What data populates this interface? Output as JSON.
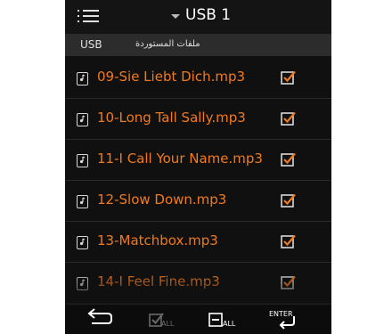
{
  "header": {
    "title": "USB 1",
    "menu_icon": "hamburger-menu-icon",
    "dropdown_icon": "caret-down-icon"
  },
  "breadcrumb": {
    "source": "USB",
    "folder": "ملفات المستوردة"
  },
  "files": [
    {
      "name": "09-Sie Liebt Dich.mp3",
      "checked": true
    },
    {
      "name": "10-Long Tall Sally.mp3",
      "checked": true
    },
    {
      "name": "11-I Call Your Name.mp3",
      "checked": true
    },
    {
      "name": "12-Slow Down.mp3",
      "checked": true
    },
    {
      "name": "13-Matchbox.mp3",
      "checked": true
    },
    {
      "name": "14-I Feel Fine.mp3",
      "checked": true
    }
  ],
  "toolbar": {
    "back_icon": "back-arrow-icon",
    "select_all_icon": "select-all-checkbox-icon",
    "select_all_label": "ALL",
    "deselect_all_icon": "deselect-all-checkbox-icon",
    "deselect_all_label": "ALL",
    "enter_label": "ENTER",
    "enter_icon": "enter-return-icon"
  },
  "colors": {
    "accent": "#f07a1c",
    "background": "#101010",
    "text": "#ffffff",
    "disabled": "#6a6a6a"
  }
}
